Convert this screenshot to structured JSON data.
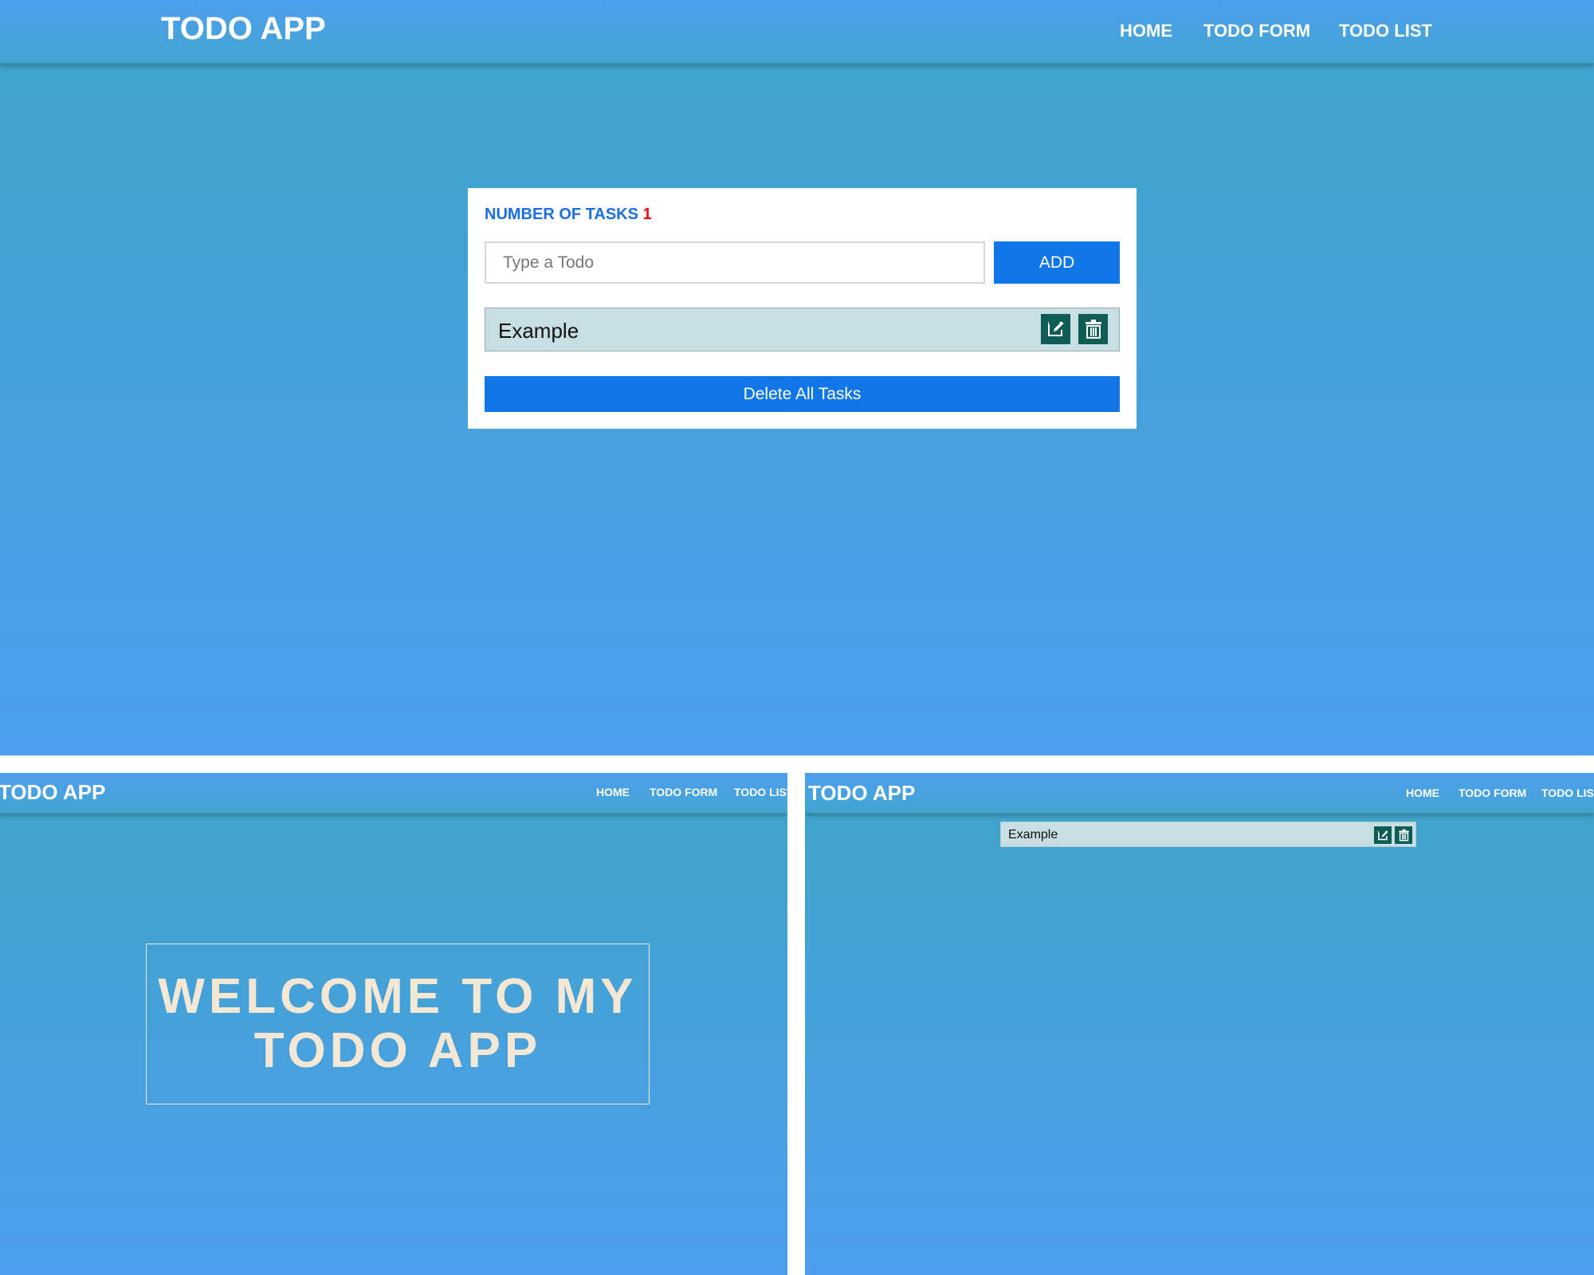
{
  "app": {
    "brand": "TODO APP",
    "nav": [
      "HOME",
      "TODO FORM",
      "TODO LIST"
    ]
  },
  "form": {
    "count_label": "NUMBER OF TASKS",
    "count": "1",
    "input_placeholder": "Type a Todo",
    "input_value": "",
    "add_label": "ADD",
    "todos": [
      "Example"
    ],
    "delete_all_label": "Delete All Tasks"
  },
  "home": {
    "welcome_line1": "WELCOME TO MY",
    "welcome_line2": "TODO APP"
  },
  "list": {
    "todos": [
      "Example"
    ]
  },
  "icons": {
    "edit": "edit-icon",
    "delete": "trash-icon"
  },
  "colors": {
    "accent": "#1177e8",
    "count": "#ee1111",
    "icon_bg": "#0d5c55",
    "item_bg": "#c7dfe3",
    "welcome_text": "#f4e7d3"
  }
}
